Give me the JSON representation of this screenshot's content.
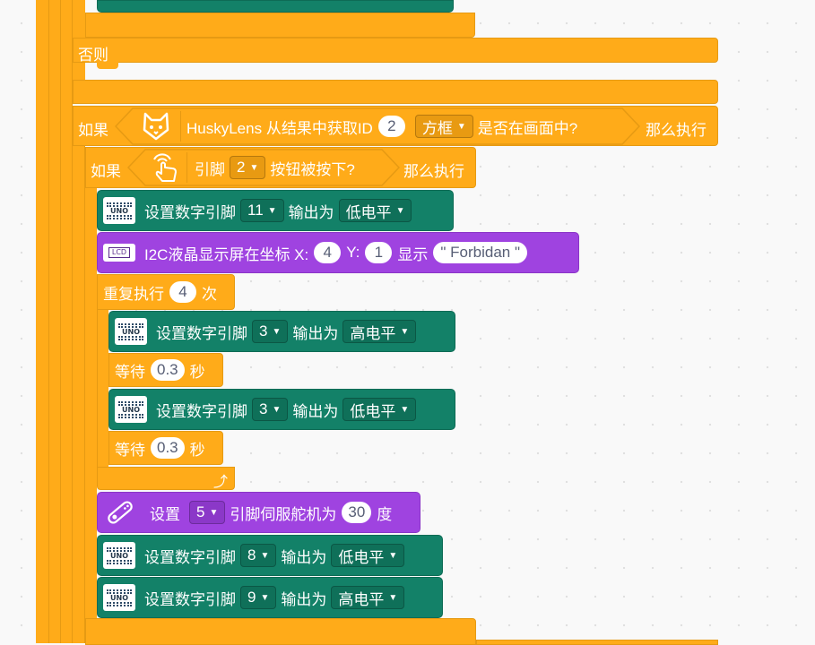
{
  "control": {
    "else_label": "否则",
    "if_label": "如果",
    "then_label": "那么执行",
    "repeat_label": "重复执行",
    "repeat_times": "4",
    "repeat_unit": "次",
    "wait_label": "等待",
    "wait_unit": "秒",
    "wait1_value": "0.3",
    "wait2_value": "0.3"
  },
  "huskylens": {
    "text": "HuskyLens 从结果中获取ID",
    "id_value": "2",
    "box_option": "方框",
    "suffix": "是否在画面中?"
  },
  "pin_button": {
    "label": "引脚",
    "pin": "2",
    "suffix": "按钮被按下?"
  },
  "gpio": {
    "label": "设置数字引脚",
    "output_label": "输出为",
    "icon_text": "UNO",
    "rows": [
      {
        "pin": "11",
        "level": "低电平"
      },
      {
        "pin": "3",
        "level": "高电平"
      },
      {
        "pin": "3",
        "level": "低电平"
      },
      {
        "pin": "8",
        "level": "低电平"
      },
      {
        "pin": "9",
        "level": "高电平"
      }
    ]
  },
  "lcd": {
    "icon_text": "LCD",
    "label": "I2C液晶显示屏在坐标 X:",
    "x": "4",
    "y_label": "Y:",
    "y": "1",
    "show_label": "显示",
    "text": "\" Forbidan \""
  },
  "servo": {
    "set_label": "设置",
    "pin": "5",
    "mid_label": "引脚伺服舵机为",
    "angle": "30",
    "unit": "度"
  },
  "colors": {
    "control": "#ffab19",
    "gpio": "#138168",
    "lcd": "#9f43e0",
    "canvas": "#f9f9f9"
  }
}
